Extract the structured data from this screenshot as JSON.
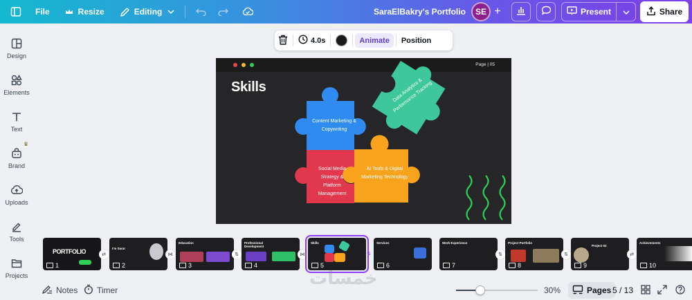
{
  "topbar": {
    "file_label": "File",
    "resize_label": "Resize",
    "editing_label": "Editing",
    "doc_title": "SaraElBakry's Portfolio",
    "avatar_initials": "SE",
    "present_label": "Present",
    "share_label": "Share",
    "gradient_colors": [
      "#14b9cf",
      "#3a8fe0",
      "#6a55e8",
      "#7d3fe6"
    ]
  },
  "rail": {
    "items": [
      {
        "label": "Design",
        "icon": "design-icon"
      },
      {
        "label": "Elements",
        "icon": "elements-icon"
      },
      {
        "label": "Text",
        "icon": "text-icon"
      },
      {
        "label": "Brand",
        "icon": "brand-icon"
      },
      {
        "label": "Uploads",
        "icon": "uploads-icon"
      },
      {
        "label": "Tools",
        "icon": "tools-icon"
      },
      {
        "label": "Projects",
        "icon": "projects-icon"
      }
    ]
  },
  "float_toolbar": {
    "duration": "4.0s",
    "animate_label": "Animate",
    "position_label": "Position",
    "color": "#1a1a1a"
  },
  "slide": {
    "page_label": "Page | 05",
    "title": "Skills",
    "pieces": [
      {
        "text": "Content Marketing & Copywriting",
        "color": "#2f8bf0"
      },
      {
        "text": "Data Analytics & Performance Tracking",
        "color": "#3ec79a"
      },
      {
        "text": "Social Media Strategy & Platform Management",
        "color": "#e2384e"
      },
      {
        "text": "AI Tools & Digital Marketing Technology",
        "color": "#f9a31c"
      }
    ],
    "squiggle_color": "#2fcf57"
  },
  "filmstrip": {
    "thumbs": [
      {
        "num": "1",
        "title": "PORTFOLIO"
      },
      {
        "num": "2",
        "title": "I'm Sara!"
      },
      {
        "num": "3",
        "title": "Education"
      },
      {
        "num": "4",
        "title": "Professional Development"
      },
      {
        "num": "5",
        "title": "Skills"
      },
      {
        "num": "6",
        "title": "Services"
      },
      {
        "num": "7",
        "title": "Work Experience"
      },
      {
        "num": "8",
        "title": "Project Portfolio"
      },
      {
        "num": "9",
        "title": "Project 02"
      },
      {
        "num": "10",
        "title": "Achievements"
      }
    ],
    "selected": "5"
  },
  "bottom": {
    "notes_label": "Notes",
    "timer_label": "Timer",
    "zoom": "30%",
    "zoom_fraction": 0.3,
    "pages_label": "Pages",
    "page_counter": "5 / 13"
  },
  "watermark": "خمسات"
}
